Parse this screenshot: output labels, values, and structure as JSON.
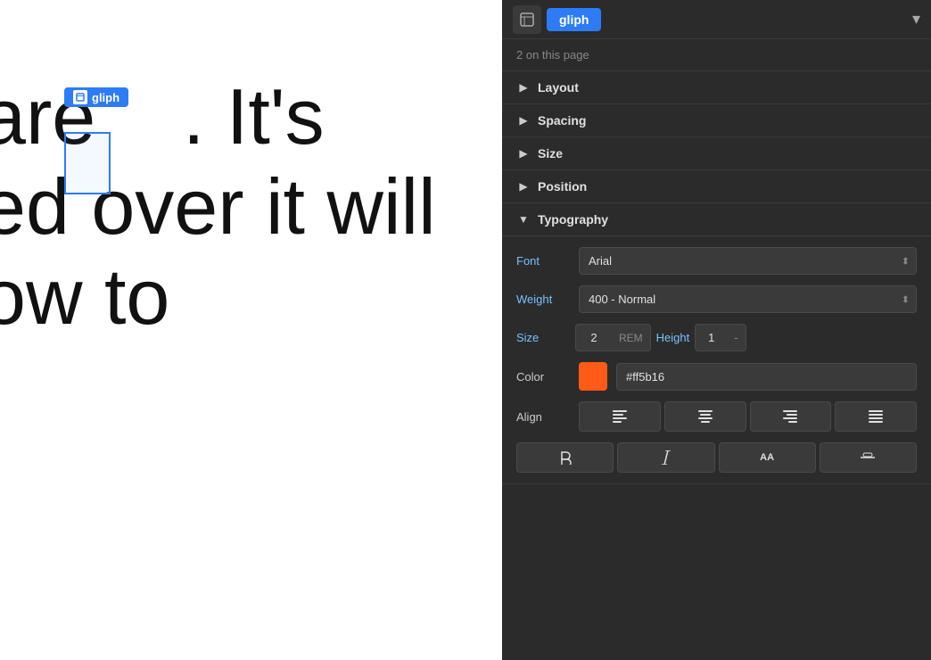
{
  "header": {
    "icon_label": "T",
    "tab_label": "gliph",
    "dropdown_char": "▾"
  },
  "sub_header": {
    "text": "2 on this page"
  },
  "sections": [
    {
      "id": "layout",
      "label": "Layout",
      "expanded": false,
      "chevron": "▶"
    },
    {
      "id": "spacing",
      "label": "Spacing",
      "expanded": false,
      "chevron": "▶"
    },
    {
      "id": "size",
      "label": "Size",
      "expanded": false,
      "chevron": "▶"
    },
    {
      "id": "position",
      "label": "Position",
      "expanded": false,
      "chevron": "▶"
    },
    {
      "id": "typography",
      "label": "Typography",
      "expanded": true,
      "chevron": "▼"
    }
  ],
  "typography": {
    "font_label": "Font",
    "font_value": "Arial",
    "weight_label": "Weight",
    "weight_value": "400 - Normal",
    "size_label": "Size",
    "size_value": "2",
    "size_unit": "REM",
    "height_label": "Height",
    "height_value": "1",
    "height_dash": "-",
    "color_label": "Color",
    "color_value": "#ff5b16",
    "color_hex": "#ff5b16",
    "align_label": "Align",
    "align_buttons": [
      "≡",
      "≡",
      "≡",
      "≡"
    ]
  },
  "canvas": {
    "text_line1": "are  . It's",
    "text_line2": "ed over it will",
    "text_line3": "ow to",
    "badge_label": "gliph"
  }
}
